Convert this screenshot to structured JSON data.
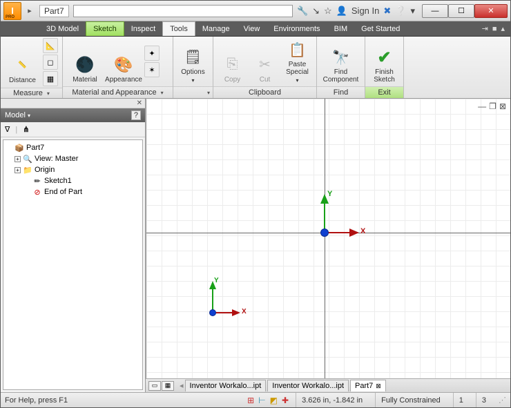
{
  "title": "Part7",
  "signin": "Sign In",
  "tabs": {
    "model3d": "3D Model",
    "sketch": "Sketch",
    "inspect": "Inspect",
    "tools": "Tools",
    "manage": "Manage",
    "view": "View",
    "envs": "Environments",
    "bim": "BIM",
    "getstarted": "Get Started"
  },
  "ribbon": {
    "distance": "Distance",
    "material": "Material",
    "appearance": "Appearance",
    "options": "Options",
    "copy": "Copy",
    "cut": "Cut",
    "paste": "Paste\nSpecial",
    "find": "Find\nComponent",
    "finish": "Finish\nSketch",
    "panel_measure": "Measure",
    "panel_matapp": "Material and Appearance",
    "panel_clip": "Clipboard",
    "panel_find": "Find",
    "panel_exit": "Exit"
  },
  "model": {
    "header": "Model",
    "root": "Part7",
    "view": "View: Master",
    "origin": "Origin",
    "sketch": "Sketch1",
    "end": "End of Part"
  },
  "ucs": {
    "x": "X",
    "y": "Y"
  },
  "doctabs": {
    "t1": "Inventor Workalo...ipt",
    "t2": "Inventor Workalo...ipt",
    "t3": "Part7"
  },
  "status": {
    "help": "For Help, press F1",
    "coords": "3.626 in, -1.842 in",
    "constraint": "Fully Constrained",
    "n1": "1",
    "n2": "3"
  }
}
